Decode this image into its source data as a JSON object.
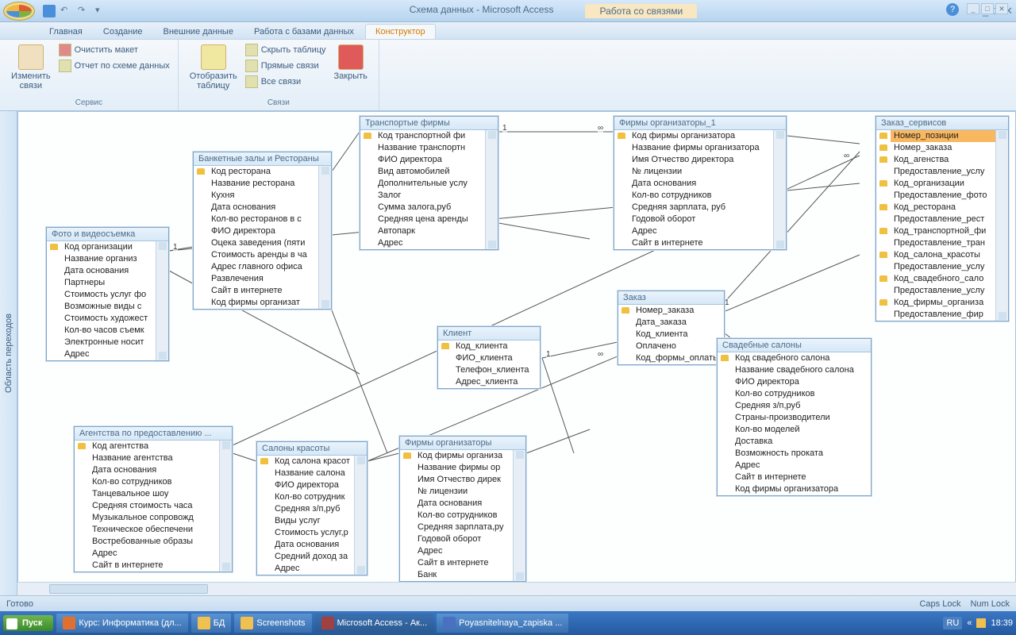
{
  "titlebar": {
    "title_left": "Схема данных - Microsoft Access",
    "title_right": "Работа со связями"
  },
  "tabs": {
    "home": "Главная",
    "create": "Создание",
    "external": "Внешние данные",
    "dbtools": "Работа с базами данных",
    "design": "Конструктор"
  },
  "ribbon": {
    "edit_rel": "Изменить\nсвязи",
    "clear_layout": "Очистить макет",
    "rel_report": "Отчет по схеме данных",
    "grp_service": "Сервис",
    "show_table": "Отобразить\nтаблицу",
    "hide_table": "Скрыть таблицу",
    "direct_rel": "Прямые связи",
    "all_rel": "Все связи",
    "grp_rel": "Связи",
    "close": "Закрыть"
  },
  "navpane": "Область переходов",
  "tables": {
    "photo": {
      "title": "Фото и видеосъемка",
      "pk": "Код организации",
      "f1": "Название организ",
      "f2": "Дата основания",
      "f3": "Партнеры",
      "f4": "Стоимость услуг фо",
      "f5": "Возможные виды с",
      "f6": "Стоимость художест",
      "f7": "Кол-во часов съемк",
      "f8": "Электронные носит",
      "f9": "Адрес"
    },
    "banquet": {
      "title": "Банкетные залы и Рестораны",
      "pk": "Код ресторана",
      "f1": "Название ресторана",
      "f2": "Кухня",
      "f3": "Дата основания",
      "f4": "Кол-во ресторанов в с",
      "f5": "ФИО директора",
      "f6": "Оцека заведения (пяти",
      "f7": "Стоимость аренды в ча",
      "f8": "Адрес главного офиса",
      "f9": "Развлечения",
      "f10": "Сайт в интернете",
      "f11": "Код фирмы организат"
    },
    "transport": {
      "title": "Транспортые фирмы",
      "pk": "Код транспортной фи",
      "f1": "Название транспортн",
      "f2": "ФИО директора",
      "f3": "Вид автомобилей",
      "f4": "Дополнительные услу",
      "f5": "Залог",
      "f6": "Сумма залога,руб",
      "f7": "Средняя цена аренды",
      "f8": "Автопарк",
      "f9": "Адрес"
    },
    "org1": {
      "title": "Фирмы организаторы_1",
      "pk": "Код фирмы организатора",
      "f1": "Название фирмы организатора",
      "f2": "Имя Отчество директора",
      "f3": "№ лицензии",
      "f4": "Дата основания",
      "f5": "Кол-во сотрудников",
      "f6": "Средняя зарплата, руб",
      "f7": "Годовой оборот",
      "f8": "Адрес",
      "f9": "Сайт в интернете"
    },
    "zakaz_srv": {
      "title": "Заказ_сервисов",
      "pk": "Номер_позиции",
      "f1": "Номер_заказа",
      "f2": "Код_агенства",
      "f3": "Предоставление_услу",
      "f4": "Код_организации",
      "f5": "Предоставление_фото",
      "f6": "Код_ресторана",
      "f7": "Предоставление_рест",
      "f8": "Код_транспортной_фи",
      "f9": "Предоставление_тран",
      "f10": "Код_салона_красоты",
      "f11": "Предоставление_услу",
      "f12": "Код_свадебного_сало",
      "f13": "Предоставление_услу",
      "f14": "Код_фирмы_организа",
      "f15": "Предоставление_фир"
    },
    "client": {
      "title": "Клиент",
      "pk": "Код_клиента",
      "f1": "ФИО_клиента",
      "f2": "Телефон_клиента",
      "f3": "Адрес_клиента"
    },
    "order": {
      "title": "Заказ",
      "pk": "Номер_заказа",
      "f1": "Дата_заказа",
      "f2": "Код_клиента",
      "f3": "Оплачено",
      "f4": "Код_формы_оплаты"
    },
    "wedding": {
      "title": "Свадебные салоны",
      "pk": "Код свадебного салона",
      "f1": "Название свадебного салона",
      "f2": "ФИО директора",
      "f3": "Кол-во сотрудников",
      "f4": "Средняя з/п,руб",
      "f5": "Страны-производители",
      "f6": "Кол-во моделей",
      "f7": "Доставка",
      "f8": "Возможность проката",
      "f9": "Адрес",
      "f10": "Сайт в интернете",
      "f11": "Код фирмы организатора"
    },
    "agency": {
      "title": "Агентства по предоставлению ...",
      "pk": "Код агентства",
      "f1": "Название агентства",
      "f2": "Дата основания",
      "f3": "Кол-во сотрудников",
      "f4": "Танцевальное шоу",
      "f5": "Средняя стоимость часа",
      "f6": "Музыкальное сопровожд",
      "f7": "Техническое обеспечени",
      "f8": "Востребованные образы",
      "f9": "Адрес",
      "f10": "Сайт в интернете"
    },
    "salon": {
      "title": "Салоны красоты",
      "pk": "Код салона красот",
      "f1": "Название салона",
      "f2": "ФИО директора",
      "f3": "Кол-во сотрудник",
      "f4": "Средняя з/п,руб",
      "f5": "Виды услуг",
      "f6": "Стоимость услуг,р",
      "f7": "Дата основания",
      "f8": "Средний доход за",
      "f9": "Адрес"
    },
    "org": {
      "title": "Фирмы организаторы",
      "pk": "Код фирмы организа",
      "f1": "Название фирмы ор",
      "f2": "Имя Отчество дирек",
      "f3": "№ лицензии",
      "f4": "Дата основания",
      "f5": "Кол-во сотрудников",
      "f6": "Средняя зарплата,ру",
      "f7": "Годовой оборот",
      "f8": "Адрес",
      "f9": "Сайт в интернете",
      "f10": "Банк"
    }
  },
  "status": {
    "ready": "Готово",
    "caps": "Caps Lock",
    "num": "Num Lock"
  },
  "taskbar": {
    "start": "Пуск",
    "b1": "Курс: Информатика (дл...",
    "b2": "БД",
    "b3": "Screenshots",
    "b4": "Microsoft Access - Ак...",
    "b5": "Poyasnitelnaya_zapiska ...",
    "lang": "RU",
    "time": "18:39"
  }
}
